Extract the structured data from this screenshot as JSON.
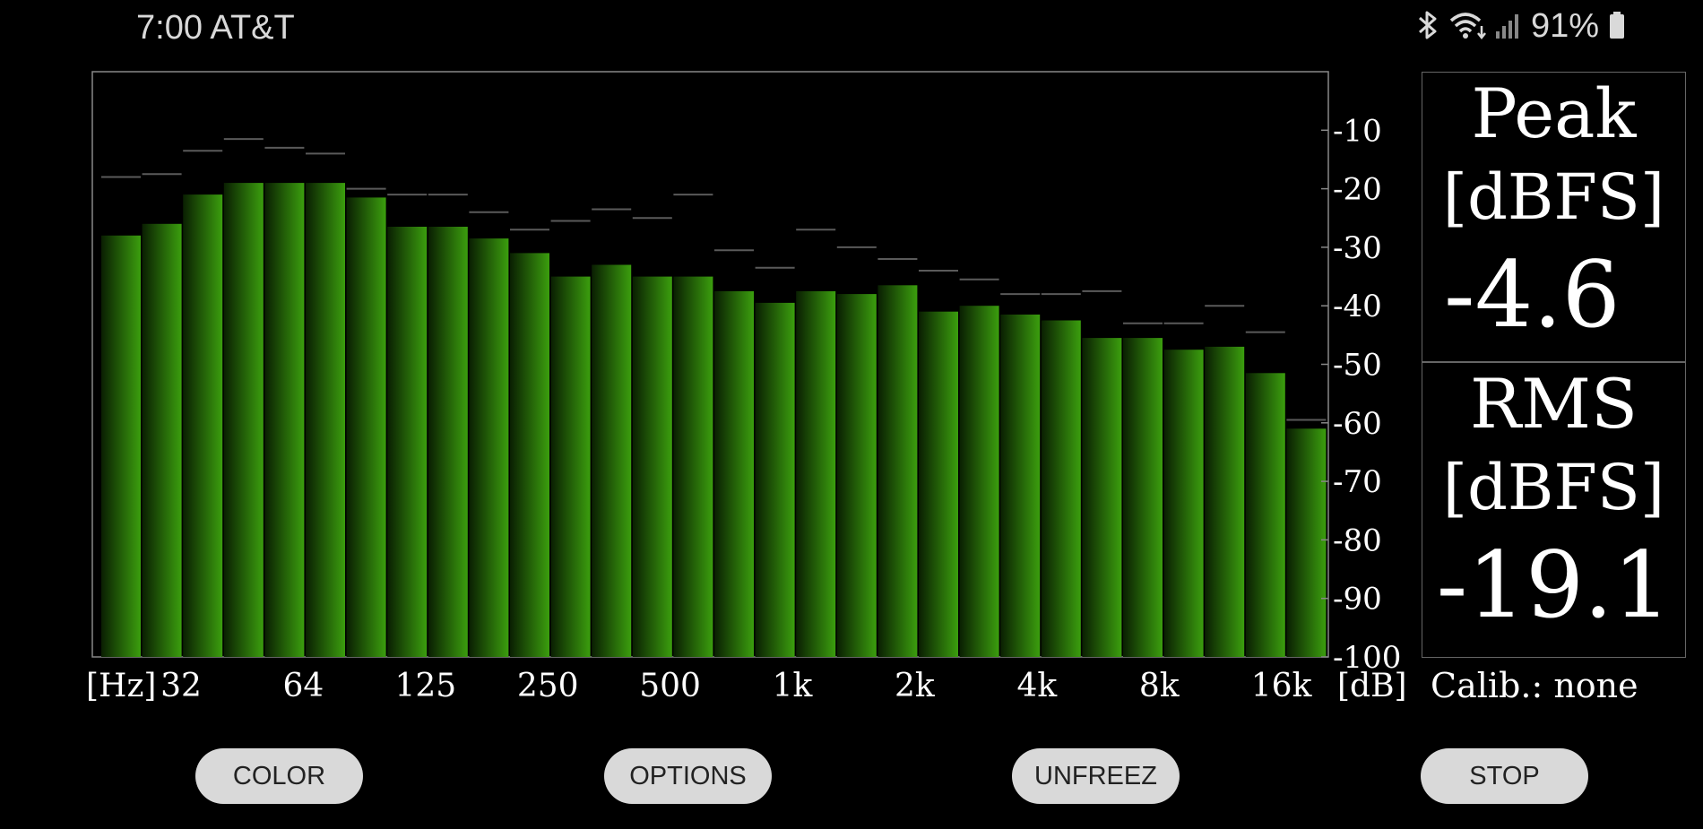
{
  "status_bar": {
    "time_carrier": "7:00 AT&T",
    "battery": "91%",
    "icons": [
      "bluetooth-icon",
      "wifi-icon",
      "signal-icon",
      "battery-icon"
    ]
  },
  "chart_data": {
    "type": "bar",
    "x_unit_label": "[Hz]",
    "y_unit_label": "[dB]",
    "x_tick_labels": [
      "32",
      "64",
      "125",
      "250",
      "500",
      "1k",
      "2k",
      "4k",
      "8k",
      "16k"
    ],
    "y_tick_labels": [
      "-10",
      "-20",
      "-30",
      "-40",
      "-50",
      "-60",
      "-70",
      "-80",
      "-90",
      "-100"
    ],
    "ylim": [
      -100,
      0
    ],
    "series": [
      {
        "values": [
          -28,
          -26,
          -21,
          -19,
          -19,
          -19,
          -21.5,
          -26.5,
          -26.5,
          -28.5,
          -31,
          -35,
          -33,
          -35,
          -35,
          -37.5,
          -39.5,
          -37.5,
          -38,
          -36.5,
          -41,
          -40,
          -41.5,
          -42.5,
          -45.5,
          -45.5,
          -47.5,
          -47,
          -51.5,
          -61
        ]
      },
      {
        "values": [
          -18,
          -17.5,
          -13.5,
          -11.5,
          -13,
          -14,
          -20,
          -21,
          -21,
          -24,
          -27,
          -25.5,
          -23.5,
          -25,
          -21,
          -30.5,
          -33.5,
          -27,
          -30,
          -32,
          -34,
          -35.5,
          -38,
          -38,
          -37.5,
          -43,
          -43,
          -40,
          -44.5,
          -59.5
        ]
      }
    ],
    "colors": {
      "bar": "#3b9e0e",
      "bar_dark": "#0a1f02",
      "peak_marker": "#5a5a5a",
      "frame": "#888888"
    }
  },
  "meters": {
    "peak": {
      "title": "Peak",
      "unit": "[dBFS]",
      "value": "-4.6"
    },
    "rms": {
      "title": "RMS",
      "unit": "[dBFS]",
      "value": "-19.1"
    }
  },
  "calibration": "Calib.: none",
  "buttons": {
    "color": "COLOR",
    "options": "OPTIONS",
    "unfreeze": "UNFREEZ",
    "stop": "STOP"
  }
}
